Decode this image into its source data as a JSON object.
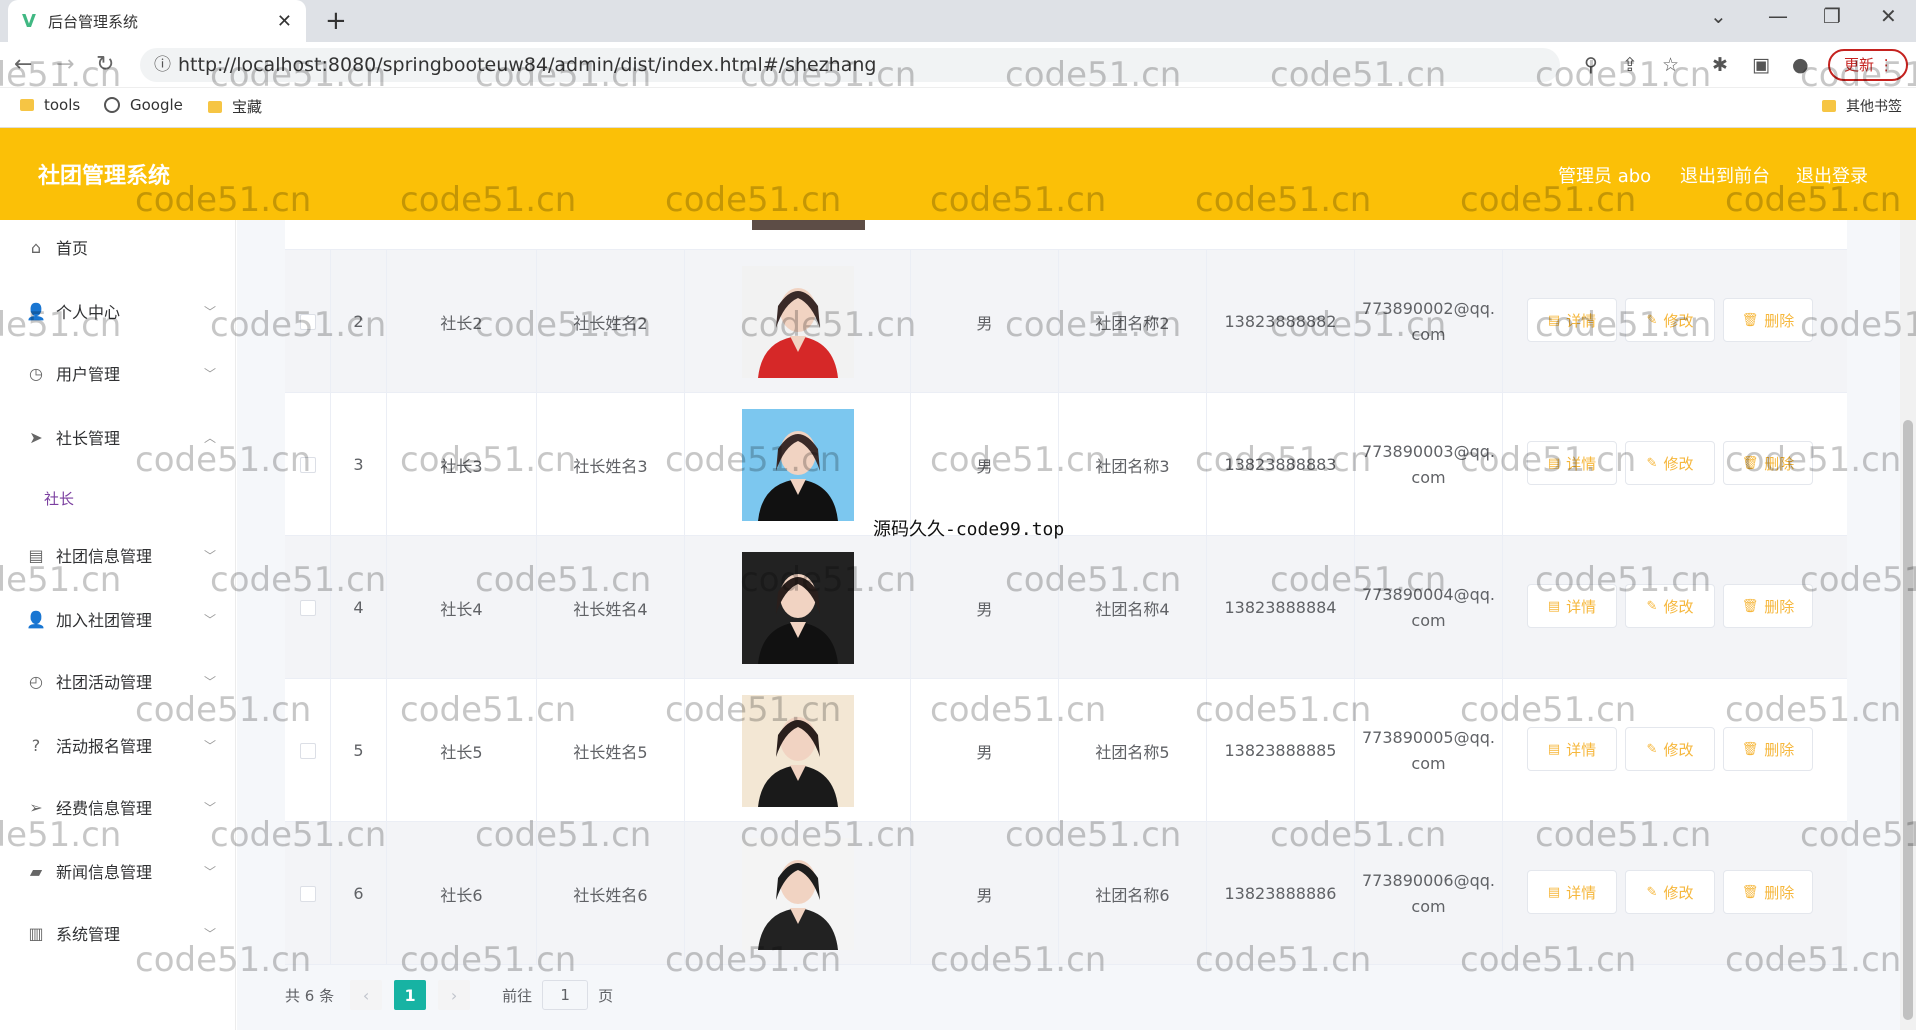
{
  "browser": {
    "tab_title": "后台管理系统",
    "url": "http://localhost:8080/springbooteuw84/admin/dist/index.html#/shezhang",
    "update_label": "更新"
  },
  "bookmarks": {
    "tools": "tools",
    "google": "Google",
    "treasure": "宝藏",
    "other": "其他书签"
  },
  "header": {
    "brand": "社团管理系统",
    "admin": "管理员 abo",
    "front": "退出到前台",
    "logout": "退出登录"
  },
  "sidebar": {
    "items": [
      "首页",
      "个人中心",
      "用户管理",
      "社长管理",
      "社团信息管理",
      "加入社团管理",
      "社团活动管理",
      "活动报名管理",
      "经费信息管理",
      "新闻信息管理",
      "系统管理"
    ],
    "sub": "社长"
  },
  "table": {
    "rows": [
      {
        "no": "2",
        "account": "社长2",
        "name": "社长姓名2",
        "sex": "男",
        "club": "社团名称2",
        "phone": "13823888882",
        "email1": "773890002@qq.",
        "email2": "com"
      },
      {
        "no": "3",
        "account": "社长3",
        "name": "社长姓名3",
        "sex": "男",
        "club": "社团名称3",
        "phone": "13823888883",
        "email1": "773890003@qq.",
        "email2": "com"
      },
      {
        "no": "4",
        "account": "社长4",
        "name": "社长姓名4",
        "sex": "男",
        "club": "社团名称4",
        "phone": "13823888884",
        "email1": "773890004@qq.",
        "email2": "com"
      },
      {
        "no": "5",
        "account": "社长5",
        "name": "社长姓名5",
        "sex": "男",
        "club": "社团名称5",
        "phone": "13823888885",
        "email1": "773890005@qq.",
        "email2": "com"
      },
      {
        "no": "6",
        "account": "社长6",
        "name": "社长姓名6",
        "sex": "男",
        "club": "社团名称6",
        "phone": "13823888886",
        "email1": "773890006@qq.",
        "email2": "com"
      }
    ],
    "detail": "详情",
    "edit": "修改",
    "delete": "删除"
  },
  "pager": {
    "total": "共 6 条",
    "current": "1",
    "goto": "前往",
    "page_value": "1",
    "page": "页"
  },
  "overlay_text": "源码久久-code99.top",
  "watermark": "code51.cn"
}
